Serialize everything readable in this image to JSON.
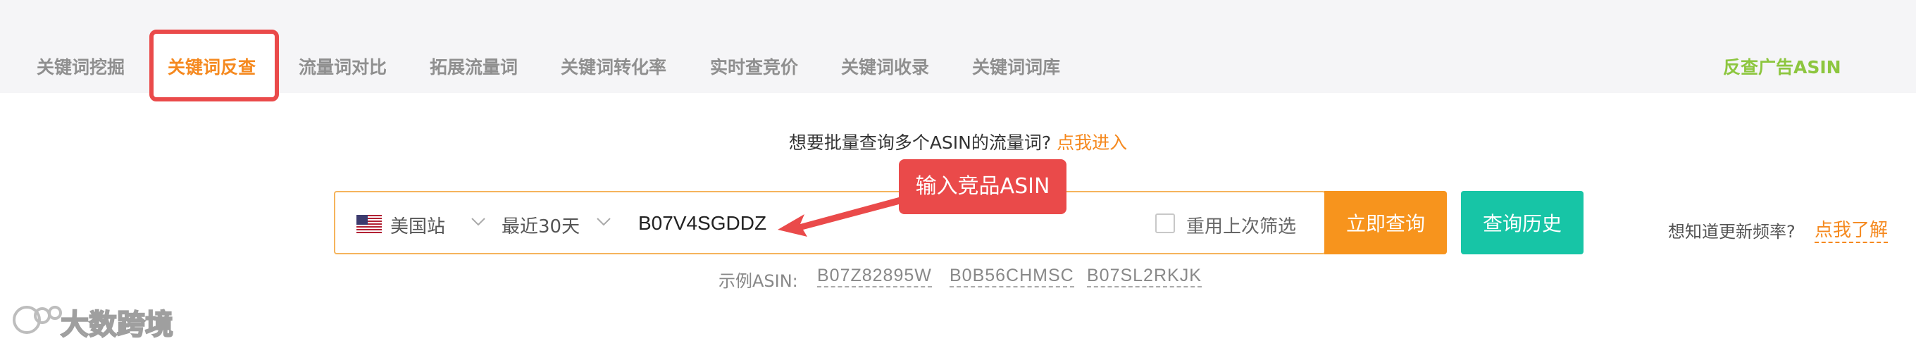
{
  "tabs": [
    {
      "label": "关键词挖掘",
      "active": false
    },
    {
      "label": "关键词反查",
      "active": true
    },
    {
      "label": "流量词对比",
      "active": false
    },
    {
      "label": "拓展流量词",
      "active": false
    },
    {
      "label": "关键词转化率",
      "active": false
    },
    {
      "label": "实时查竞价",
      "active": false
    },
    {
      "label": "关键词收录",
      "active": false
    },
    {
      "label": "关键词词库",
      "active": false
    }
  ],
  "tab_right": "反查广告ASIN",
  "hint": {
    "text": "想要批量查询多个ASIN的流量词?",
    "link": "点我进入"
  },
  "search": {
    "site_flag_icon": "us-flag-icon",
    "site": "美国站",
    "period": "最近30天",
    "asin_value": "B07V4SGDDZ",
    "reuse_label": "重用上次筛选",
    "reuse_checked": false
  },
  "buttons": {
    "query": "立即查询",
    "history": "查询历史"
  },
  "frequency": {
    "question": "想知道更新频率?",
    "link": "点我了解"
  },
  "examples": {
    "label": "示例ASIN:",
    "items": [
      "B07Z82895W",
      "B0B56CHMSC",
      "B07SL2RKJK"
    ]
  },
  "annotation": {
    "text": "输入竞品ASIN"
  },
  "watermark": {
    "text": "大数跨境"
  },
  "colors": {
    "accent": "#f7941d",
    "history": "#17c5a6",
    "annotation": "#ea4a4a",
    "tab_right": "#8dc63f"
  }
}
